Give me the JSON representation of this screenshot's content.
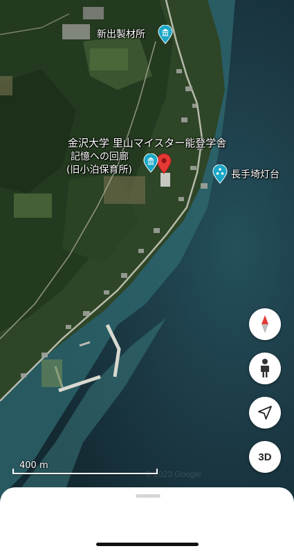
{
  "map": {
    "places": [
      {
        "name": "新出製材所",
        "icon": "museum-icon"
      },
      {
        "name": "金沢大学 里山マイスター能登学舎",
        "icon": "location-pin-icon"
      },
      {
        "name_line1": "記憶への回廊",
        "name_line2": "(旧小泊保育所)",
        "icon": "museum-icon"
      },
      {
        "name": "長手埼灯台",
        "icon": "lighthouse-icon"
      }
    ],
    "scale_label": "400 m",
    "colors": {
      "poi_teal": "#1ba7c6",
      "selected_pin_red": "#e53935",
      "sea": "#1d3a44",
      "land": "#2f4a2a"
    }
  },
  "controls": {
    "compass_icon": "compass-icon",
    "street_view_icon": "pegman-icon",
    "location_icon": "navigation-arrow-icon",
    "view_3d_label": "3D"
  }
}
